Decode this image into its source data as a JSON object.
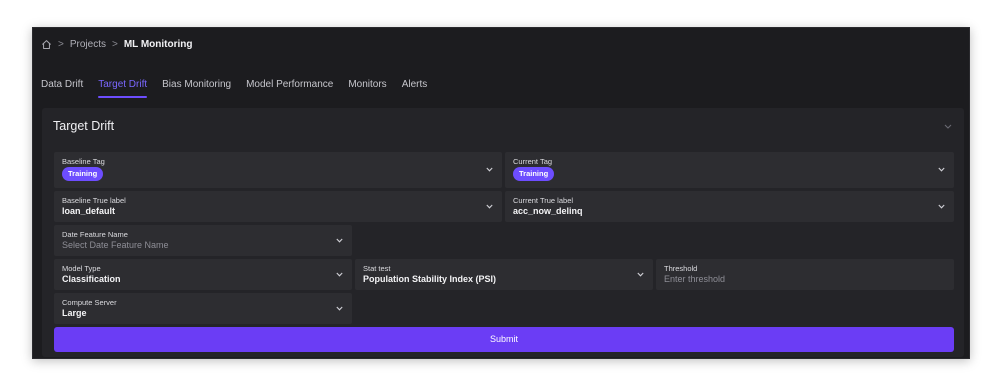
{
  "breadcrumb": {
    "home_icon": "home-icon",
    "projects": "Projects",
    "current": "ML Monitoring",
    "separator": ">"
  },
  "tabs": [
    {
      "label": "Data Drift"
    },
    {
      "label": "Target Drift",
      "active": true
    },
    {
      "label": "Bias Monitoring"
    },
    {
      "label": "Model Performance"
    },
    {
      "label": "Monitors"
    },
    {
      "label": "Alerts"
    }
  ],
  "panel": {
    "title": "Target Drift",
    "fields": {
      "baseline_tag": {
        "label": "Baseline Tag",
        "value": "Training"
      },
      "current_tag": {
        "label": "Current Tag",
        "value": "Training"
      },
      "baseline_true_label": {
        "label": "Baseline True label",
        "value": "loan_default"
      },
      "current_true_label": {
        "label": "Current True label",
        "value": "acc_now_delinq"
      },
      "date_feature_name": {
        "label": "Date Feature Name",
        "placeholder": "Select Date Feature Name"
      },
      "model_type": {
        "label": "Model Type",
        "value": "Classification"
      },
      "stat_test": {
        "label": "Stat test",
        "value": "Population Stability Index (PSI)"
      },
      "threshold": {
        "label": "Threshold",
        "placeholder": "Enter threshold"
      },
      "compute_server": {
        "label": "Compute Server",
        "value": "Large"
      }
    },
    "submit_label": "Submit"
  },
  "colors": {
    "accent": "#6d4dff",
    "background": "#1c1c1f",
    "panel": "#242428",
    "field": "#2d2d31"
  }
}
